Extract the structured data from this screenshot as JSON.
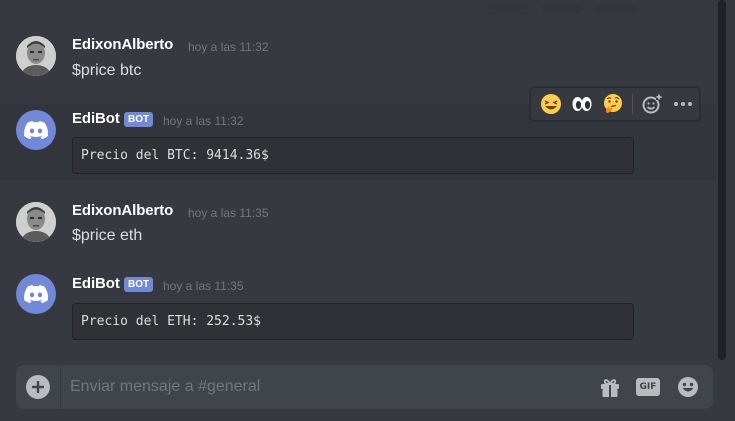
{
  "messages": [
    {
      "username": "EdixonAlberto",
      "timestamp": "hoy a las 11:32",
      "text": "$price btc",
      "avatar_icon": "user-photo-avatar"
    },
    {
      "username": "EdiBot",
      "bot_tag": "BOT",
      "timestamp": "hoy a las 11:32",
      "code": "Precio del BTC: 9414.36$",
      "avatar_icon": "discord-logo-icon"
    },
    {
      "username": "EdixonAlberto",
      "timestamp": "hoy a las 11:35",
      "text": "$price eth",
      "avatar_icon": "user-photo-avatar"
    },
    {
      "username": "EdiBot",
      "bot_tag": "BOT",
      "timestamp": "hoy a las 11:35",
      "code": "Precio del ETH: 252.53$",
      "avatar_icon": "discord-logo-icon"
    }
  ],
  "hover_toolbar": {
    "reactions": [
      "laughing-emoji",
      "eyes-emoji",
      "thinking-emoji"
    ],
    "actions": [
      "add-reaction-icon",
      "more-options-icon"
    ]
  },
  "composer": {
    "placeholder": "Enviar mensaje a #general",
    "gif_label": "GIF",
    "icons": [
      "attach-plus-icon",
      "gift-icon",
      "gif-icon",
      "emoji-picker-icon"
    ]
  },
  "colors": {
    "background": "#36393f",
    "blurple": "#7289da",
    "username": "#ffffff",
    "timestamp": "#72767d",
    "code_background": "#2f3136",
    "composer_background": "#40444b"
  }
}
